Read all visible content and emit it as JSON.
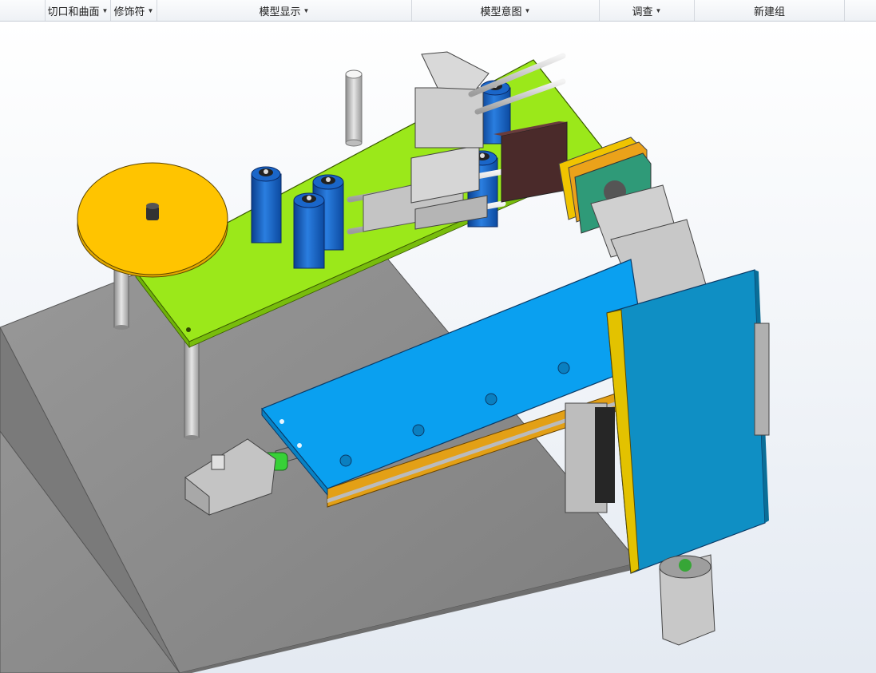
{
  "ribbon": {
    "groups": [
      {
        "label": "切口和曲面"
      },
      {
        "label": "修饰符"
      },
      {
        "label": "模型显示"
      },
      {
        "label": "模型意图"
      },
      {
        "label": "调查"
      },
      {
        "label": "新建组"
      }
    ]
  },
  "colors": {
    "base_plate": "#8f8f8f",
    "green_plate": "#9be81a",
    "turntable": "#ffc400",
    "blue_plate": "#0aa0f0",
    "vertical_panel": "#0f8fc4",
    "battery": "#1565c8",
    "orange_slide": "#e3a016",
    "metal": "#c8c8c8",
    "coupling": "#37d137"
  },
  "icons": [
    "dropdown-caret-icon"
  ]
}
